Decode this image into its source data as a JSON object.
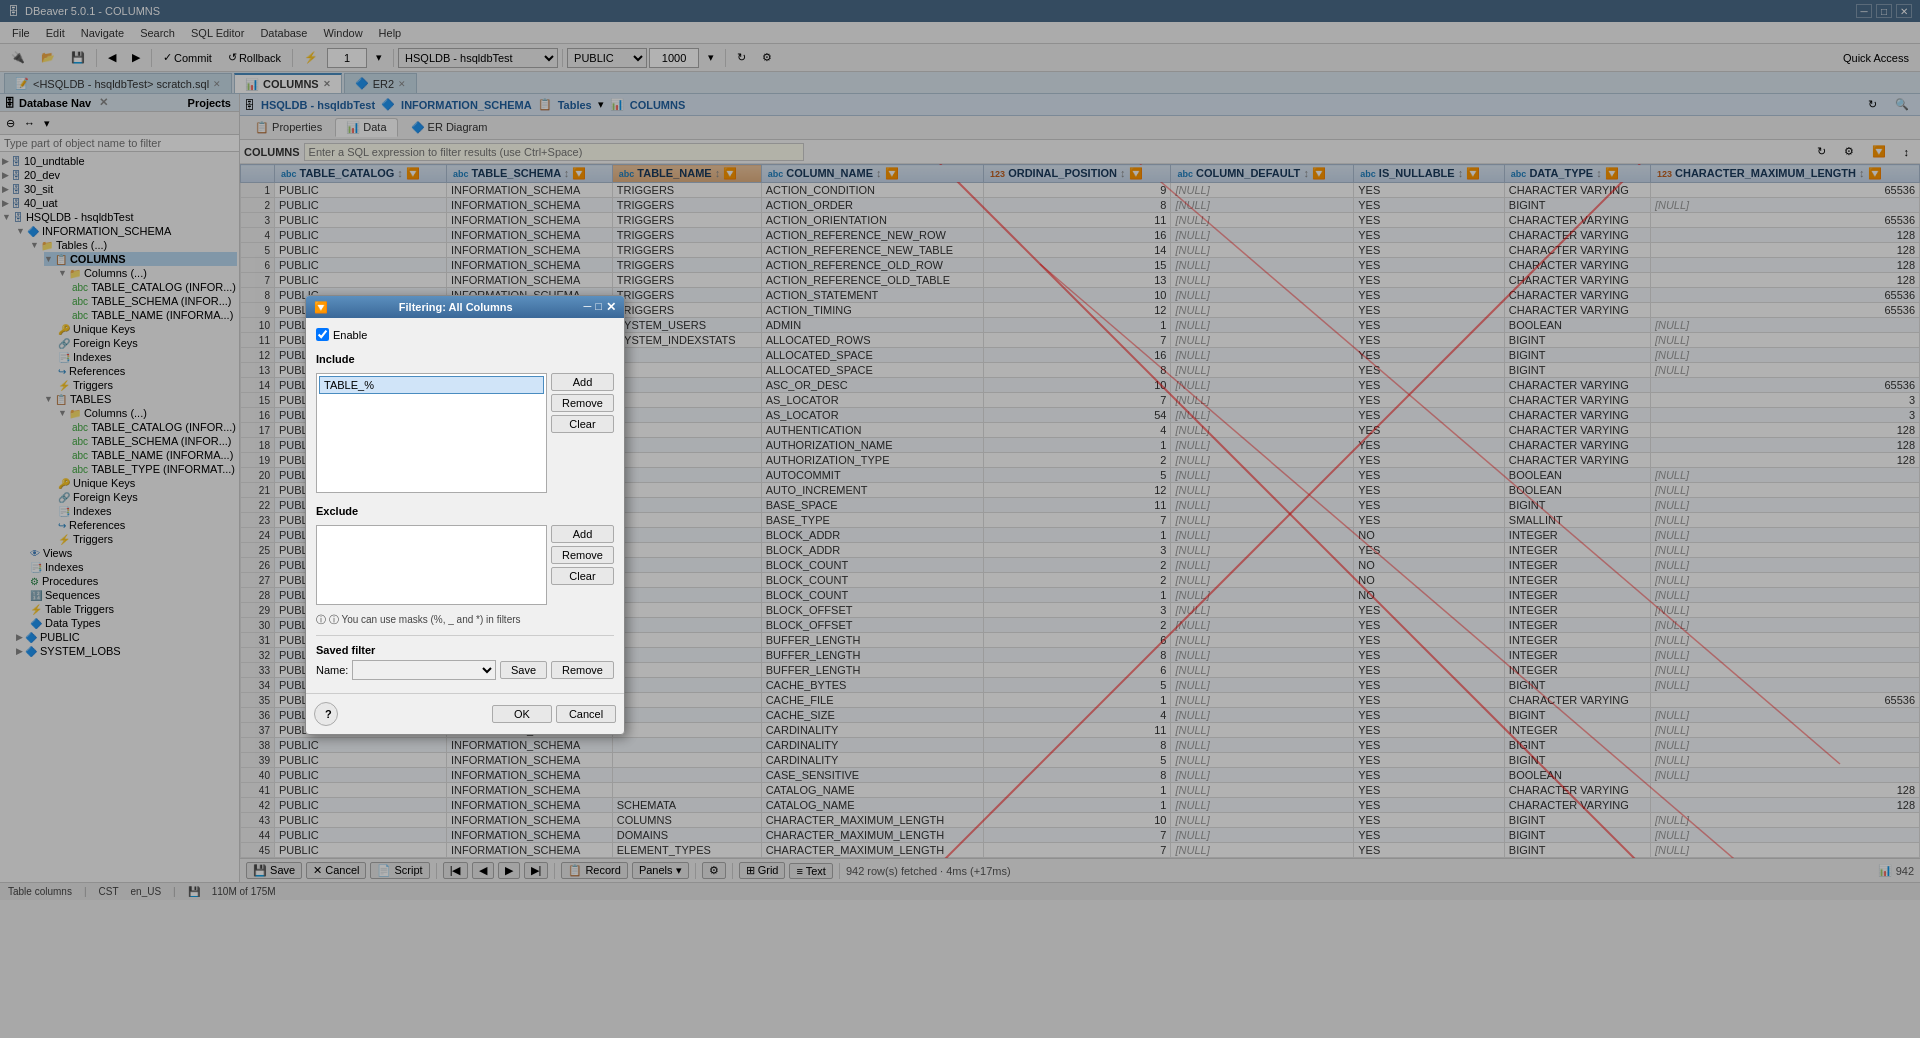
{
  "app": {
    "title": "DBeaver 5.0.1 - COLUMNS",
    "version": "5.0.1"
  },
  "title_bar": {
    "title": "DBeaver 5.0.1 - COLUMNS"
  },
  "menu": {
    "items": [
      "File",
      "Edit",
      "Navigate",
      "Search",
      "SQL Editor",
      "Database",
      "Window",
      "Help"
    ]
  },
  "toolbar": {
    "commit_label": "Commit",
    "rollback_label": "Rollback",
    "transaction_input": "1",
    "connection_select": "HSQLDB - hsqldbTest",
    "schema_select": "PUBLIC",
    "limit_input": "1000",
    "quick_access": "Quick Access"
  },
  "tabs": {
    "items": [
      {
        "label": "<HSQLDB - hsqldbTest> scratch.sql",
        "active": false
      },
      {
        "label": "COLUMNS",
        "active": true
      },
      {
        "label": "ER2",
        "active": false
      }
    ]
  },
  "connection_bar": {
    "db_label": "HSQLDB - hsqldbTest",
    "schema_label": "INFORMATION_SCHEMA",
    "type_label": "Tables",
    "view_label": "COLUMNS"
  },
  "sub_tabs": {
    "items": [
      "Properties",
      "Data",
      "ER Diagram"
    ]
  },
  "filter_bar": {
    "label": "COLUMNS",
    "placeholder": "Enter a SQL expression to filter results (use Ctrl+Space)"
  },
  "left_panel": {
    "title": "Database Nav",
    "filter_placeholder": "Type part of object name to filter",
    "tree": [
      {
        "label": "10_undtable",
        "level": 0,
        "type": "folder",
        "expand": true
      },
      {
        "label": "20_dev",
        "level": 0,
        "type": "folder",
        "expand": true
      },
      {
        "label": "30_sit",
        "level": 0,
        "type": "folder",
        "expand": true
      },
      {
        "label": "40_uat",
        "level": 0,
        "type": "folder",
        "expand": true
      },
      {
        "label": "HSQLDB - hsqldbTest",
        "level": 0,
        "type": "db",
        "expand": false
      },
      {
        "label": "INFORMATION_SCHEMA",
        "level": 1,
        "type": "schema",
        "expand": false
      },
      {
        "label": "Tables (...)",
        "level": 2,
        "type": "folder",
        "expand": false
      },
      {
        "label": "COLUMNS",
        "level": 3,
        "type": "table",
        "expand": false,
        "selected": true
      },
      {
        "label": "Columns (...)",
        "level": 4,
        "type": "folder",
        "expand": false
      },
      {
        "label": "TABLE_CATALOG (INFOR...)",
        "level": 5,
        "type": "col"
      },
      {
        "label": "TABLE_SCHEMA (INFOR...)",
        "level": 5,
        "type": "col"
      },
      {
        "label": "TABLE_NAME (INFORMA...)",
        "level": 5,
        "type": "col"
      },
      {
        "label": "Unique Keys",
        "level": 4,
        "type": "key"
      },
      {
        "label": "Foreign Keys",
        "level": 4,
        "type": "ref"
      },
      {
        "label": "Indexes",
        "level": 4,
        "type": "idx"
      },
      {
        "label": "References",
        "level": 4,
        "type": "ref"
      },
      {
        "label": "Triggers",
        "level": 4,
        "type": "trig"
      },
      {
        "label": "TABLES",
        "level": 2,
        "type": "table",
        "expand": false
      },
      {
        "label": "Columns (...)",
        "level": 3,
        "type": "folder",
        "expand": false
      },
      {
        "label": "TABLE_CATALOG (INFOR...)",
        "level": 4,
        "type": "col"
      },
      {
        "label": "TABLE_SCHEMA (INFOR...)",
        "level": 4,
        "type": "col"
      },
      {
        "label": "TABLE_NAME (INFORMA...)",
        "level": 4,
        "type": "col"
      },
      {
        "label": "TABLE_TYPE (INFORMAT...)",
        "level": 4,
        "type": "col"
      },
      {
        "label": "Unique Keys",
        "level": 3,
        "type": "key"
      },
      {
        "label": "Foreign Keys",
        "level": 3,
        "type": "ref"
      },
      {
        "label": "Indexes",
        "level": 3,
        "type": "idx"
      },
      {
        "label": "References",
        "level": 3,
        "type": "ref"
      },
      {
        "label": "Triggers",
        "level": 3,
        "type": "trig"
      },
      {
        "label": "Views",
        "level": 2,
        "type": "view"
      },
      {
        "label": "Indexes",
        "level": 2,
        "type": "idx"
      },
      {
        "label": "Procedures",
        "level": 2,
        "type": "proc"
      },
      {
        "label": "Sequences",
        "level": 2,
        "type": "seq"
      },
      {
        "label": "Table Triggers",
        "level": 2,
        "type": "trig"
      },
      {
        "label": "Data Types",
        "level": 2,
        "type": "type"
      },
      {
        "label": "PUBLIC",
        "level": 1,
        "type": "schema"
      },
      {
        "label": "SYSTEM_LOBS",
        "level": 1,
        "type": "schema"
      }
    ]
  },
  "grid": {
    "columns": [
      "",
      "TABLE_CATALOG",
      "TABLE_SCHEMA",
      "TABLE_NAME",
      "COLUMN_NAME",
      "ORDINAL_POSITION",
      "COLUMN_DEFAULT",
      "IS_NULLABLE",
      "DATA_TYPE",
      "CHARACTER_MAXIMUM_LENGTH"
    ],
    "rows": [
      [
        1,
        "PUBLIC",
        "INFORMATION_SCHEMA",
        "TRIGGERS",
        "ACTION_CONDITION",
        9,
        "[NULL]",
        "YES",
        "CHARACTER VARYING",
        65536
      ],
      [
        2,
        "PUBLIC",
        "INFORMATION_SCHEMA",
        "TRIGGERS",
        "ACTION_ORDER",
        8,
        "[NULL]",
        "YES",
        "BIGINT",
        "[NULL]"
      ],
      [
        3,
        "PUBLIC",
        "INFORMATION_SCHEMA",
        "TRIGGERS",
        "ACTION_ORIENTATION",
        11,
        "[NULL]",
        "YES",
        "CHARACTER VARYING",
        65536
      ],
      [
        4,
        "PUBLIC",
        "INFORMATION_SCHEMA",
        "TRIGGERS",
        "ACTION_REFERENCE_NEW_ROW",
        16,
        "[NULL]",
        "YES",
        "CHARACTER VARYING",
        128
      ],
      [
        5,
        "PUBLIC",
        "INFORMATION_SCHEMA",
        "TRIGGERS",
        "ACTION_REFERENCE_NEW_TABLE",
        14,
        "[NULL]",
        "YES",
        "CHARACTER VARYING",
        128
      ],
      [
        6,
        "PUBLIC",
        "INFORMATION_SCHEMA",
        "TRIGGERS",
        "ACTION_REFERENCE_OLD_ROW",
        15,
        "[NULL]",
        "YES",
        "CHARACTER VARYING",
        128
      ],
      [
        7,
        "PUBLIC",
        "INFORMATION_SCHEMA",
        "TRIGGERS",
        "ACTION_REFERENCE_OLD_TABLE",
        13,
        "[NULL]",
        "YES",
        "CHARACTER VARYING",
        128
      ],
      [
        8,
        "PUBLIC",
        "INFORMATION_SCHEMA",
        "TRIGGERS",
        "ACTION_STATEMENT",
        10,
        "[NULL]",
        "YES",
        "CHARACTER VARYING",
        65536
      ],
      [
        9,
        "PUBLIC",
        "INFORMATION_SCHEMA",
        "TRIGGERS",
        "ACTION_TIMING",
        12,
        "[NULL]",
        "YES",
        "CHARACTER VARYING",
        65536
      ],
      [
        10,
        "PUBLIC",
        "INFORMATION_SCHEMA",
        "SYSTEM_USERS",
        "ADMIN",
        1,
        "[NULL]",
        "YES",
        "BOOLEAN",
        "[NULL]"
      ],
      [
        11,
        "PUBLIC",
        "INFORMATION_SCHEMA",
        "SYSTEM_INDEXSTATS",
        "ALLOCATED_ROWS",
        7,
        "[NULL]",
        "YES",
        "BIGINT",
        "[NULL]"
      ],
      [
        12,
        "PUBLIC",
        "INFORMATION_SCHEMA",
        "",
        "ALLOCATED_SPACE",
        16,
        "[NULL]",
        "YES",
        "BIGINT",
        "[NULL]"
      ],
      [
        13,
        "PUBLIC",
        "INFORMATION_SCHEMA",
        "",
        "ALLOCATED_SPACE",
        8,
        "[NULL]",
        "YES",
        "BIGINT",
        "[NULL]"
      ],
      [
        14,
        "PUBLIC",
        "INFORMATION_SCHEMA",
        "",
        "ASC_OR_DESC",
        10,
        "[NULL]",
        "YES",
        "CHARACTER VARYING",
        65536
      ],
      [
        15,
        "PUBLIC",
        "INFORMATION_SCHEMA",
        "",
        "AS_LOCATOR",
        7,
        "[NULL]",
        "YES",
        "CHARACTER VARYING",
        3
      ],
      [
        16,
        "PUBLIC",
        "INFORMATION_SCHEMA",
        "",
        "AS_LOCATOR",
        54,
        "[NULL]",
        "YES",
        "CHARACTER VARYING",
        3
      ],
      [
        17,
        "PUBLIC",
        "INFORMATION_SCHEMA",
        "",
        "AUTHENTICATION",
        4,
        "[NULL]",
        "YES",
        "CHARACTER VARYING",
        128
      ],
      [
        18,
        "PUBLIC",
        "INFORMATION_SCHEMA",
        "",
        "AUTHORIZATION_NAME",
        1,
        "[NULL]",
        "YES",
        "CHARACTER VARYING",
        128
      ],
      [
        19,
        "PUBLIC",
        "INFORMATION_SCHEMA",
        "",
        "AUTHORIZATION_TYPE",
        2,
        "[NULL]",
        "YES",
        "CHARACTER VARYING",
        128
      ],
      [
        20,
        "PUBLIC",
        "INFORMATION_SCHEMA",
        "",
        "AUTOCOMMIT",
        5,
        "[NULL]",
        "YES",
        "BOOLEAN",
        "[NULL]"
      ],
      [
        21,
        "PUBLIC",
        "INFORMATION_SCHEMA",
        "",
        "AUTO_INCREMENT",
        12,
        "[NULL]",
        "YES",
        "BOOLEAN",
        "[NULL]"
      ],
      [
        22,
        "PUBLIC",
        "INFORMATION_SCHEMA",
        "",
        "BASE_SPACE",
        11,
        "[NULL]",
        "YES",
        "BIGINT",
        "[NULL]"
      ],
      [
        23,
        "PUBLIC",
        "INFORMATION_SCHEMA",
        "",
        "BASE_TYPE",
        7,
        "[NULL]",
        "YES",
        "SMALLINT",
        "[NULL]"
      ],
      [
        24,
        "PUBLIC",
        "INFORMATION_SCHEMA",
        "",
        "BLOCK_ADDR",
        1,
        "[NULL]",
        "NO",
        "INTEGER",
        "[NULL]"
      ],
      [
        25,
        "PUBLIC",
        "INFORMATION_SCHEMA",
        "",
        "BLOCK_ADDR",
        3,
        "[NULL]",
        "YES",
        "INTEGER",
        "[NULL]"
      ],
      [
        26,
        "PUBLIC",
        "INFORMATION_SCHEMA",
        "",
        "BLOCK_COUNT",
        2,
        "[NULL]",
        "NO",
        "INTEGER",
        "[NULL]"
      ],
      [
        27,
        "PUBLIC",
        "INFORMATION_SCHEMA",
        "",
        "BLOCK_COUNT",
        2,
        "[NULL]",
        "NO",
        "INTEGER",
        "[NULL]"
      ],
      [
        28,
        "PUBLIC",
        "INFORMATION_SCHEMA",
        "",
        "BLOCK_COUNT",
        1,
        "[NULL]",
        "NO",
        "INTEGER",
        "[NULL]"
      ],
      [
        29,
        "PUBLIC",
        "INFORMATION_SCHEMA",
        "",
        "BLOCK_OFFSET",
        3,
        "[NULL]",
        "YES",
        "INTEGER",
        "[NULL]"
      ],
      [
        30,
        "PUBLIC",
        "INFORMATION_SCHEMA",
        "",
        "BLOCK_OFFSET",
        2,
        "[NULL]",
        "YES",
        "INTEGER",
        "[NULL]"
      ],
      [
        31,
        "PUBLIC",
        "INFORMATION_SCHEMA",
        "",
        "BUFFER_LENGTH",
        6,
        "[NULL]",
        "YES",
        "INTEGER",
        "[NULL]"
      ],
      [
        32,
        "PUBLIC",
        "INFORMATION_SCHEMA",
        "",
        "BUFFER_LENGTH",
        8,
        "[NULL]",
        "YES",
        "INTEGER",
        "[NULL]"
      ],
      [
        33,
        "PUBLIC",
        "INFORMATION_SCHEMA",
        "",
        "BUFFER_LENGTH",
        6,
        "[NULL]",
        "YES",
        "INTEGER",
        "[NULL]"
      ],
      [
        34,
        "PUBLIC",
        "INFORMATION_SCHEMA",
        "",
        "CACHE_BYTES",
        5,
        "[NULL]",
        "YES",
        "BIGINT",
        "[NULL]"
      ],
      [
        35,
        "PUBLIC",
        "INFORMATION_SCHEMA",
        "",
        "CACHE_FILE",
        1,
        "[NULL]",
        "YES",
        "CHARACTER VARYING",
        65536
      ],
      [
        36,
        "PUBLIC",
        "INFORMATION_SCHEMA",
        "",
        "CACHE_SIZE",
        4,
        "[NULL]",
        "YES",
        "BIGINT",
        "[NULL]"
      ],
      [
        37,
        "PUBLIC",
        "INFORMATION_SCHEMA",
        "",
        "CARDINALITY",
        11,
        "[NULL]",
        "YES",
        "INTEGER",
        "[NULL]"
      ],
      [
        38,
        "PUBLIC",
        "INFORMATION_SCHEMA",
        "",
        "CARDINALITY",
        8,
        "[NULL]",
        "YES",
        "BIGINT",
        "[NULL]"
      ],
      [
        39,
        "PUBLIC",
        "INFORMATION_SCHEMA",
        "",
        "CARDINALITY",
        5,
        "[NULL]",
        "YES",
        "BIGINT",
        "[NULL]"
      ],
      [
        40,
        "PUBLIC",
        "INFORMATION_SCHEMA",
        "",
        "CASE_SENSITIVE",
        8,
        "[NULL]",
        "YES",
        "BOOLEAN",
        "[NULL]"
      ],
      [
        41,
        "PUBLIC",
        "INFORMATION_SCHEMA",
        "",
        "CATALOG_NAME",
        1,
        "[NULL]",
        "YES",
        "CHARACTER VARYING",
        128
      ],
      [
        42,
        "PUBLIC",
        "INFORMATION_SCHEMA",
        "SCHEMATA",
        "CATALOG_NAME",
        1,
        "[NULL]",
        "YES",
        "CHARACTER VARYING",
        128
      ],
      [
        43,
        "PUBLIC",
        "INFORMATION_SCHEMA",
        "COLUMNS",
        "CHARACTER_MAXIMUM_LENGTH",
        10,
        "[NULL]",
        "YES",
        "BIGINT",
        "[NULL]"
      ],
      [
        44,
        "PUBLIC",
        "INFORMATION_SCHEMA",
        "DOMAINS",
        "CHARACTER_MAXIMUM_LENGTH",
        7,
        "[NULL]",
        "YES",
        "BIGINT",
        "[NULL]"
      ],
      [
        45,
        "PUBLIC",
        "INFORMATION_SCHEMA",
        "ELEMENT_TYPES",
        "CHARACTER_MAXIMUM_LENGTH",
        7,
        "[NULL]",
        "YES",
        "BIGINT",
        "[NULL]"
      ]
    ]
  },
  "modal": {
    "title": "Filtering: All Columns",
    "enable_label": "Enable",
    "enable_checked": true,
    "include_label": "Include",
    "exclude_label": "Exclude",
    "include_value": "TABLE_%",
    "remove_label": "Remove",
    "clear_label": "Clear",
    "add_label": "Add",
    "hint": "ⓘ You can use masks (%, _ and *) in filters",
    "saved_filter_label": "Saved filter",
    "name_label": "Name:",
    "name_placeholder": "",
    "save_label": "Save",
    "remove_filter_label": "Remove",
    "ok_label": "OK",
    "cancel_label": "Cancel",
    "help_icon": "?"
  },
  "bottom_toolbar": {
    "save_label": "Save",
    "cancel_label": "Cancel",
    "script_label": "Script",
    "record_label": "Record",
    "panels_label": "Panels",
    "grid_label": "Grid",
    "text_label": "Text",
    "status_text": "942 row(s) fetched · 4ms (+17ms)",
    "row_count": "942"
  },
  "status_bar": {
    "timezone": "CST",
    "locale": "en_US",
    "memory": "110M of 175M"
  }
}
